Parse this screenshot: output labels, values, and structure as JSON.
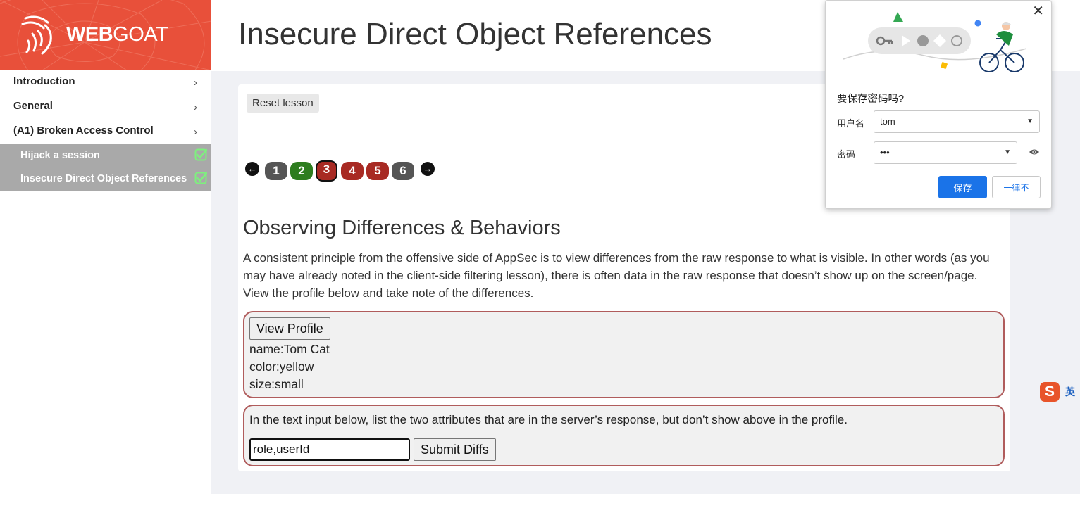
{
  "brand": {
    "logo_bold": "WEB",
    "logo_light": "GOAT"
  },
  "header": {
    "title": "Insecure Direct Object References"
  },
  "sidebar": {
    "categories": [
      {
        "label": "Introduction",
        "chevron": "›"
      },
      {
        "label": "General",
        "chevron": "›"
      },
      {
        "label": "(A1) Broken Access Control",
        "chevron": "›"
      }
    ],
    "subitems": [
      {
        "label": "Hijack a session",
        "completed": true
      },
      {
        "label": "Insecure Direct Object References",
        "completed": true
      }
    ]
  },
  "lesson": {
    "reset_label": "Reset lesson",
    "pages": [
      {
        "label": "1",
        "status": "gray"
      },
      {
        "label": "2",
        "status": "green"
      },
      {
        "label": "3",
        "status": "active"
      },
      {
        "label": "4",
        "status": "red"
      },
      {
        "label": "5",
        "status": "red"
      },
      {
        "label": "6",
        "status": "gray"
      }
    ],
    "prev_icon": "arrow-left-icon",
    "next_icon": "arrow-right-icon",
    "section_title": "Observing Differences & Behaviors",
    "paragraph": "A consistent principle from the offensive side of AppSec is to view differences from the raw response to what is visible. In other words (as you may have already noted in the client-side filtering lesson), there is often data in the raw response that doesn’t show up on the screen/page. View the profile below and take note of the differences.",
    "view_profile_label": "View Profile",
    "profile": {
      "name": "name:Tom Cat",
      "color": "color:yellow",
      "size": "size:small"
    },
    "diff_instruction": "In the text input below, list the two attributes that are in the server’s response, but don’t show above in the profile.",
    "diff_value": "role,userId",
    "submit_label": "Submit Diffs"
  },
  "password_popup": {
    "title": "要保存密码吗?",
    "username_label": "用户名",
    "username_value": "tom",
    "password_label": "密码",
    "password_value": "•••",
    "save_label": "保存",
    "never_label": "一律不",
    "close_glyph": "✕"
  },
  "ime": {
    "logo": "S",
    "mode": "英"
  },
  "colors": {
    "brand": "#e8503a",
    "page_green": "#2e7d1f",
    "page_red": "#a82a23",
    "page_gray": "#555555",
    "box_border": "#b05c5c",
    "primary_blue": "#1a73e8"
  }
}
